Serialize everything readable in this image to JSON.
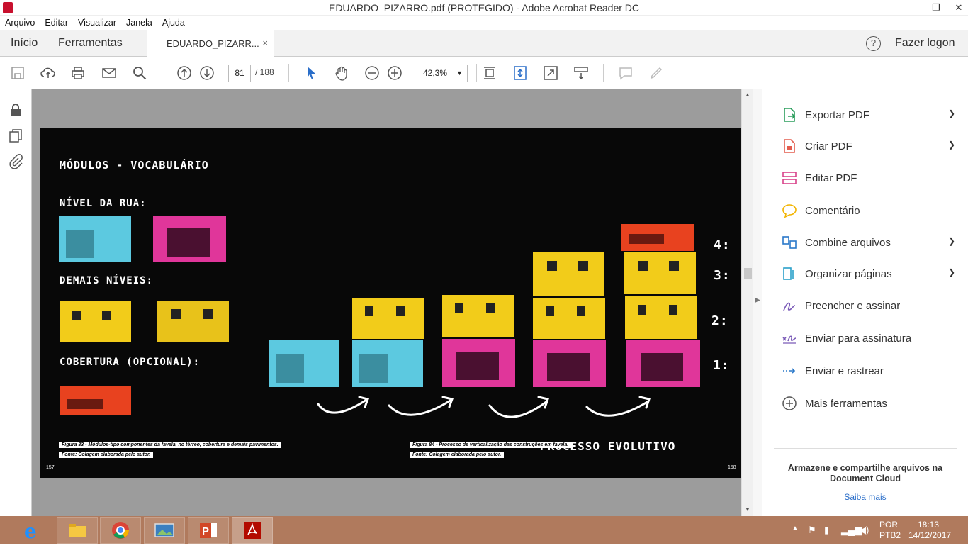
{
  "window": {
    "title": "EDUARDO_PIZARRO.pdf (PROTEGIDO) - Adobe Acrobat Reader DC",
    "minimize": "—",
    "maximize": "❐",
    "close": "✕"
  },
  "menu": [
    "Arquivo",
    "Editar",
    "Visualizar",
    "Janela",
    "Ajuda"
  ],
  "tabs": {
    "home": "Início",
    "tools": "Ferramentas",
    "doc": "EDUARDO_PIZARR...",
    "close": "×"
  },
  "header": {
    "help": "?",
    "login": "Fazer logon"
  },
  "toolbar": {
    "page_current": "81",
    "page_total": "/  188",
    "zoom": "42,3%"
  },
  "document": {
    "title_modules": "MÓDULOS - VOCABULÁRIO",
    "street_level": "NÍVEL DA RUA:",
    "other_levels": "DEMAIS NÍVEIS:",
    "roof": "COBERTURA (OPCIONAL):",
    "process": "PROCESSO EVOLUTIVO",
    "levels": [
      "4:",
      "3:",
      "2:",
      "1:"
    ],
    "caption_left_1": "Figura 83 - Módulos-tipo componentes da favela, no térreo, cobertura e demais pavimentos.",
    "caption_left_2": "Fonte: Colagem elaborada pelo autor.",
    "caption_right_1": "Figura 84 - Processo de verticalização das construções em favela.",
    "caption_right_2": "Fonte: Colagem elaborada pelo autor.",
    "page_left": "157",
    "page_right": "158"
  },
  "tools_panel": [
    {
      "label": "Exportar PDF",
      "chevron": true,
      "icon": "export-pdf-icon",
      "color": "#2a9d5c"
    },
    {
      "label": "Criar PDF",
      "chevron": true,
      "icon": "create-pdf-icon",
      "color": "#e35d4f"
    },
    {
      "label": "Editar PDF",
      "chevron": false,
      "icon": "edit-pdf-icon",
      "color": "#d9428a"
    },
    {
      "label": "Comentário",
      "chevron": false,
      "icon": "comment-icon",
      "color": "#f2b400"
    },
    {
      "label": "Combine arquivos",
      "chevron": true,
      "icon": "combine-icon",
      "color": "#2a78c9"
    },
    {
      "label": "Organizar páginas",
      "chevron": true,
      "icon": "organize-icon",
      "color": "#2aa0c9"
    },
    {
      "label": "Preencher e assinar",
      "chevron": false,
      "icon": "fill-sign-icon",
      "color": "#7a5ab8"
    },
    {
      "label": "Enviar para assinatura",
      "chevron": false,
      "icon": "send-sign-icon",
      "color": "#7a5ab8"
    },
    {
      "label": "Enviar e rastrear",
      "chevron": false,
      "icon": "send-track-icon",
      "color": "#2a78c9"
    },
    {
      "label": "Mais ferramentas",
      "chevron": false,
      "icon": "more-tools-icon",
      "color": "#555"
    }
  ],
  "cloud": {
    "text": "Armazene e compartilhe arquivos na Document Cloud",
    "link": "Saiba mais"
  },
  "taskbar": {
    "lang1": "POR",
    "lang2": "PTB2",
    "time": "18:13",
    "date": "14/12/2017"
  }
}
